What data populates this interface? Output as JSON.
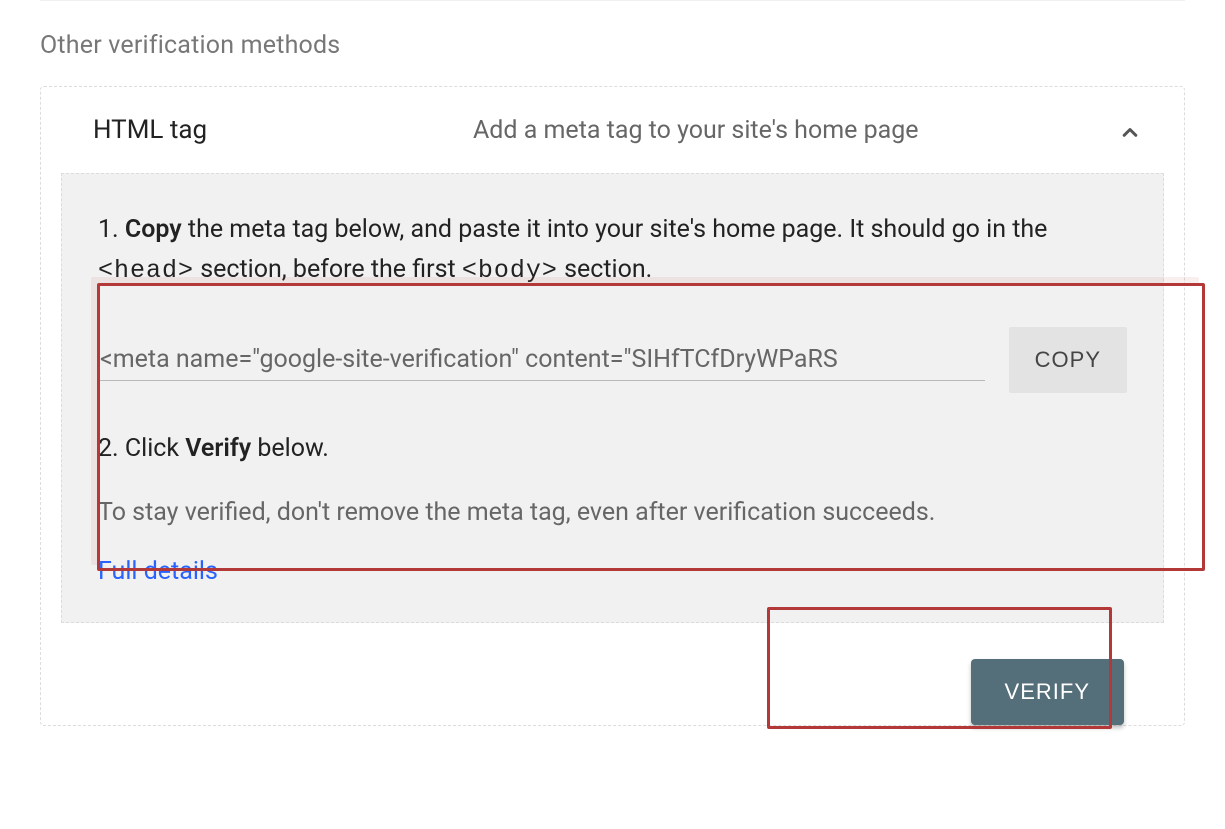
{
  "section_title": "Other verification methods",
  "accordion": {
    "title": "HTML tag",
    "subtitle": "Add a meta tag to your site's home page"
  },
  "body": {
    "step1_prefix": "1. ",
    "step1_bold": "Copy",
    "step1_text_a": " the meta tag below, and paste it into your site's home page. It should go in the ",
    "step1_head": "<head>",
    "step1_text_b": " section, before the first ",
    "step1_body": "<body>",
    "step1_text_c": " section.",
    "meta_value": "<meta name=\"google-site-verification\" content=\"SIHfTCfDryWPaRS",
    "copy_label": "COPY",
    "step2_prefix": "2. Click ",
    "step2_bold": "Verify",
    "step2_suffix": " below.",
    "stay_text": "To stay verified, don't remove the meta tag, even after verification succeeds.",
    "full_details": "Full details",
    "verify_label": "VERIFY"
  }
}
